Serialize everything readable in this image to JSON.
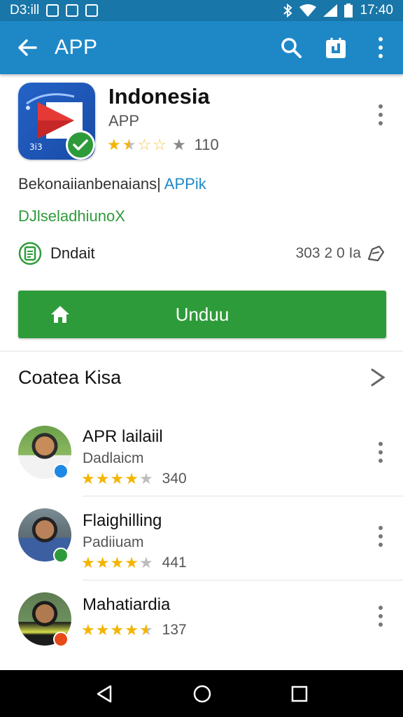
{
  "status_bar": {
    "left_text": "D3:ill",
    "time": "17:40",
    "icons": [
      "notification-icon",
      "image-icon",
      "screenshot-icon",
      "bluetooth-icon",
      "wifi-icon",
      "signal-icon",
      "battery-icon"
    ]
  },
  "app_bar": {
    "title": "APP",
    "icons": [
      "back-arrow-icon",
      "search-icon",
      "store-icon",
      "more-vert-icon"
    ]
  },
  "app": {
    "name": "Indonesia",
    "subtitle": "APP",
    "icon_badge_text": "3i3",
    "rating_stars": 2.5,
    "rating_count": "110",
    "developer_text": "Bekonaiianbenaians|",
    "developer_link": "APPik",
    "green_text": "DJlseladhiunoX",
    "info_label": "Dndait",
    "info_size": "303 2 0 Ia",
    "install_label": "Unduu"
  },
  "section": {
    "title": "Coatea Kisa"
  },
  "reviews": [
    {
      "name": "APR lailaiil",
      "sub": "Dadlaicm",
      "stars": 4,
      "count": "340",
      "badge_color": "#1e88e5"
    },
    {
      "name": "Flaighilling",
      "sub": "Padiiuam",
      "stars": 4,
      "count": "441",
      "badge_color": "#2e9b3a"
    },
    {
      "name": "Mahatiardia",
      "sub": "",
      "stars": 4.5,
      "count": "137",
      "badge_color": "#e64a19"
    }
  ],
  "colors": {
    "status_bar": "#1976a8",
    "app_bar": "#1e88c7",
    "install_button": "#2e9b3a",
    "star": "#f4b400"
  }
}
